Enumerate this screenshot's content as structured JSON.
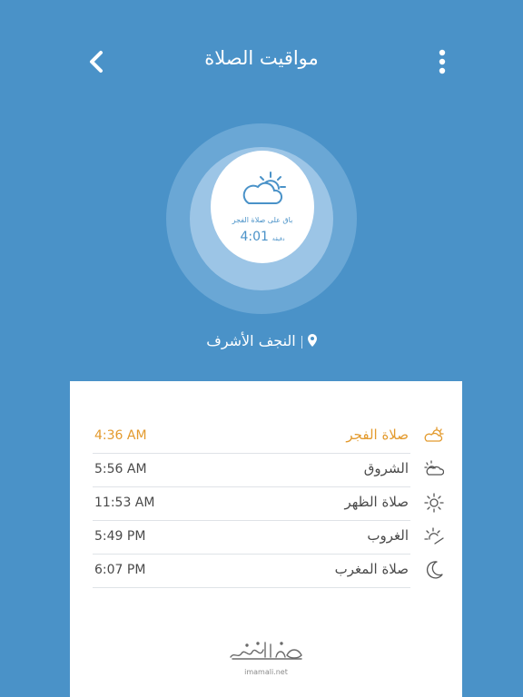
{
  "header": {
    "title": "مواقيت الصلاة"
  },
  "countdown": {
    "label": "باق على صلاة الفجر",
    "time": "4:01",
    "unit": "دقيقة"
  },
  "location": {
    "name": "النجف الأشرف"
  },
  "prayers": [
    {
      "name": "صلاة الفجر",
      "time": "4:36 AM",
      "icon": "sun-behind-cloud-icon",
      "active": true
    },
    {
      "name": "الشروق",
      "time": "5:56 AM",
      "icon": "cloud-sun-icon",
      "active": false
    },
    {
      "name": "صلاة الظهر",
      "time": "11:53 AM",
      "icon": "sun-icon",
      "active": false
    },
    {
      "name": "الغروب",
      "time": "5:49 PM",
      "icon": "sunset-icon",
      "active": false
    },
    {
      "name": "صلاة المغرب",
      "time": "6:07 PM",
      "icon": "moon-icon",
      "active": false
    }
  ],
  "footer": {
    "site": "imamali.net"
  },
  "colors": {
    "background": "#4a92c8",
    "accent": "#e39a2d",
    "text": "#4a4a4a"
  }
}
